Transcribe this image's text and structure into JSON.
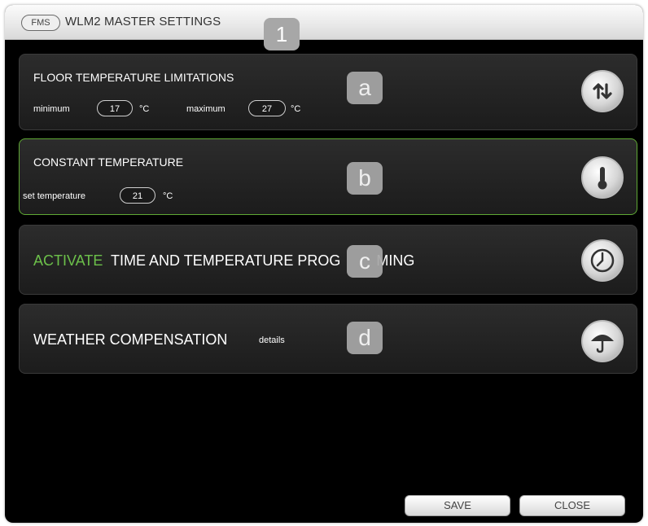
{
  "window": {
    "logo": "FMS",
    "title": "WLM2 MASTER SETTINGS",
    "marker": "1"
  },
  "floor_limits": {
    "title": "FLOOR TEMPERATURE LIMITATIONS",
    "min_label": "minimum",
    "min_value": "17",
    "max_label": "maximum",
    "max_value": "27",
    "unit": "°C",
    "marker": "a",
    "icon": "up-down-arrows-icon"
  },
  "constant_temp": {
    "title": "CONSTANT TEMPERATURE",
    "set_label": "set temperature",
    "set_value": "21",
    "unit": "°C",
    "marker": "b",
    "icon": "thermometer-icon"
  },
  "programming": {
    "activate": "ACTIVATE",
    "title_prefix": "TIME AND TEMPERATURE PROG",
    "title_suffix": "MING",
    "marker": "c",
    "icon": "clock-icon"
  },
  "weather": {
    "title": "WEATHER COMPENSATION",
    "details": "details",
    "marker": "d",
    "icon": "umbrella-icon"
  },
  "buttons": {
    "save": "SAVE",
    "close": "CLOSE"
  },
  "colors": {
    "accent_green": "#6cc04a",
    "active_border": "#5fa834",
    "panel_bg": "#242424",
    "marker_gray": "#a7a7a7"
  }
}
